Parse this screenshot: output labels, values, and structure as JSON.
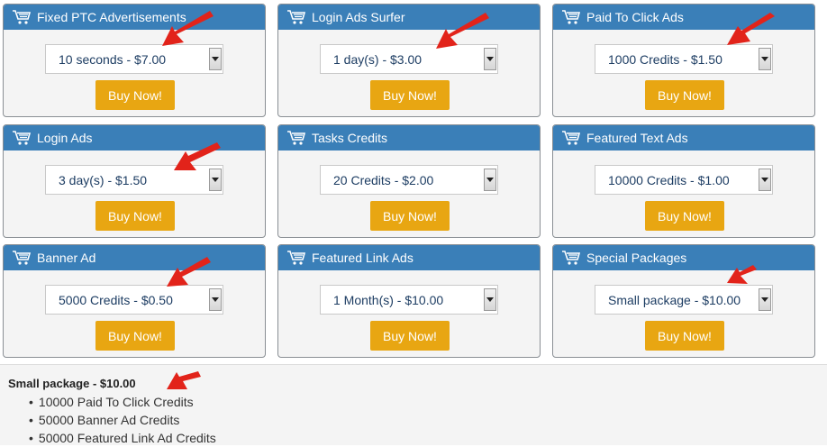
{
  "colors": {
    "header": "#3a7fb8",
    "button": "#e8a612",
    "arrow": "#e2231a"
  },
  "buy_label": "Buy Now!",
  "cards": [
    {
      "title": "Fixed PTC Advertisements",
      "selected": "10 seconds - $7.00"
    },
    {
      "title": "Login Ads Surfer",
      "selected": "1 day(s) - $3.00"
    },
    {
      "title": "Paid To Click Ads",
      "selected": "1000 Credits - $1.50"
    },
    {
      "title": "Login Ads",
      "selected": "3 day(s) - $1.50"
    },
    {
      "title": "Tasks Credits",
      "selected": "20 Credits - $2.00"
    },
    {
      "title": "Featured Text Ads",
      "selected": "10000 Credits - $1.00"
    },
    {
      "title": "Banner Ad",
      "selected": "5000 Credits - $0.50"
    },
    {
      "title": "Featured Link Ads",
      "selected": "1 Month(s) - $10.00"
    },
    {
      "title": "Special Packages",
      "selected": "Small package - $10.00"
    }
  ],
  "package_info": {
    "title": "Small package - $10.00",
    "items": [
      "10000 Paid To Click Credits",
      "50000 Banner Ad Credits",
      "50000 Featured Link Ad Credits"
    ]
  }
}
